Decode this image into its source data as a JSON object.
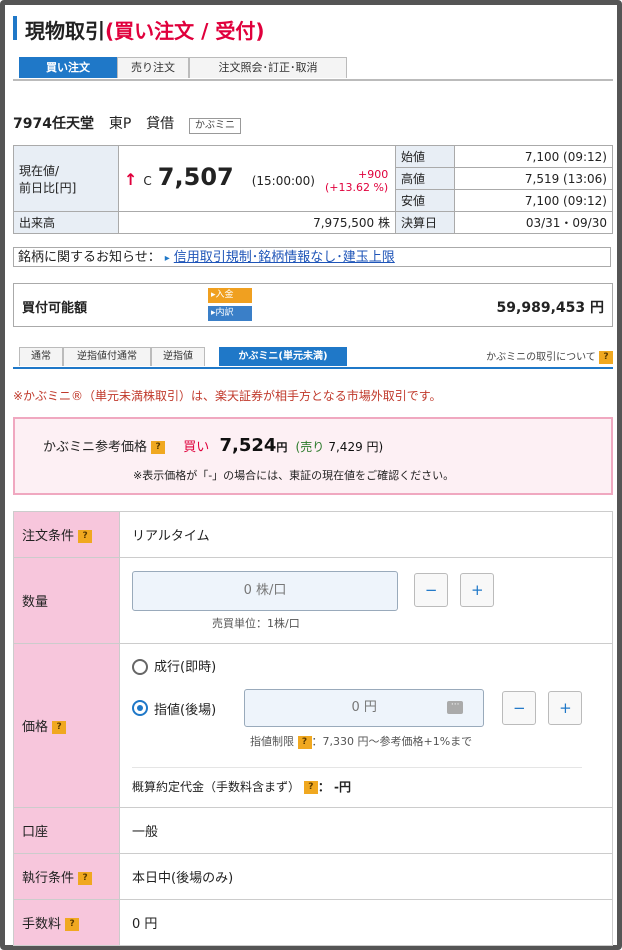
{
  "header": {
    "title_main": "現物取引",
    "title_accent": "(買い注文 / 受付)",
    "tabs": [
      "買い注文",
      "売り注文",
      "注文照会･訂正･取消"
    ]
  },
  "stock": {
    "code_name": "7974任天堂",
    "market": "東P",
    "margin": "貸借",
    "tag": "かぶミニ"
  },
  "quote": {
    "current_label": "現在値/\n前日比[円]",
    "arrow": "↑",
    "flag": "C",
    "current_value": "7,507",
    "time": "(15:00:00)",
    "change": "+900",
    "change_pct": "(+13.62 %)",
    "open_label": "始値",
    "open_value": "7,100 (09:12)",
    "high_label": "高値",
    "high_value": "7,519 (13:06)",
    "low_label": "安値",
    "low_value": "7,100 (09:12)",
    "volume_label": "出来高",
    "volume_value": "7,975,500 株",
    "settle_label": "決算日",
    "settle_value": "03/31・09/30"
  },
  "notice": {
    "label": "銘柄に関するお知らせ：",
    "link": "信用取引規制･銘柄情報なし･建玉上限"
  },
  "buying_power": {
    "label": "買付可能額",
    "deposit_btn": "入金",
    "detail_btn": "内訳",
    "value": "59,989,453 円"
  },
  "sub_tabs": [
    "通常",
    "逆指値付通常",
    "逆指値",
    "かぶミニ(単元未満)"
  ],
  "about_link": "かぶミニの取引について",
  "warning": "※かぶミニ®（単元未満株取引）は、楽天証券が相手方となる市場外取引です。",
  "reference": {
    "label": "かぶミニ参考価格",
    "buy_label": "買い",
    "buy_value": "7,524",
    "yen": "円",
    "sell_label": "(売り",
    "sell_value": "7,429 円)",
    "note": "※表示価格が「-」の場合には、東証の現在値をご確認ください。"
  },
  "form": {
    "condition_label": "注文条件",
    "condition_value": "リアルタイム",
    "qty_label": "数量",
    "qty_value": "0 株/口",
    "qty_unit_note": "売買単位：1株/口",
    "price_label": "価格",
    "market_option": "成行(即時)",
    "limit_option": "指値(後場)",
    "price_value": "0 円",
    "limit_note_prefix": "指値制限",
    "limit_note": "：7,330 円〜参考価格+1%まで",
    "estimate_label": "概算約定代金（手数料含まず）",
    "estimate_value": "：  -円",
    "account_label": "口座",
    "account_value": "一般",
    "exec_label": "執行条件",
    "exec_value": "本日中(後場のみ)",
    "fee_label": "手数料",
    "fee_value": "0 円"
  }
}
